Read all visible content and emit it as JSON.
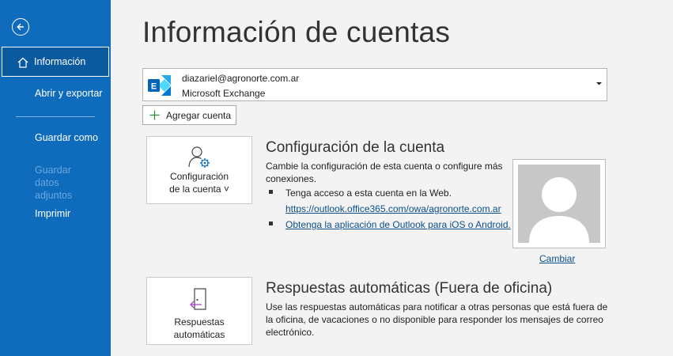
{
  "sidebar": {
    "back_label": "Atrás",
    "items": [
      {
        "label": "Información"
      },
      {
        "label": "Abrir y exportar"
      },
      {
        "label": "Guardar como"
      },
      {
        "label": "Guardar datos adjuntos"
      },
      {
        "label": "Imprimir"
      }
    ]
  },
  "page": {
    "title": "Información de cuentas"
  },
  "account": {
    "email": "diazariel@agronorte.com.ar",
    "type": "Microsoft Exchange",
    "add_label": "Agregar cuenta"
  },
  "account_settings": {
    "tile_line1": "Configuración",
    "tile_line2": "de la cuenta ˅",
    "title": "Configuración de la cuenta",
    "description": "Cambie la configuración de esta cuenta o configure más conexiones.",
    "bullet1": "Tenga acceso a esta cuenta en la Web.",
    "link1": "https://outlook.office365.com/owa/agronorte.com.ar",
    "link2": "Obtenga la aplicación de Outlook para iOS o Android.",
    "change_photo": "Cambiar"
  },
  "auto_replies": {
    "tile_line1": "Respuestas",
    "tile_line2": "automáticas",
    "title": "Respuestas automáticas (Fuera de oficina)",
    "description": "Use las respuestas automáticas para notificar a otras personas que está fuera de la oficina, de vacaciones o no disponible para responder los mensajes de correo electrónico."
  },
  "colors": {
    "sidebar": "#0f6cbd",
    "accent_link": "#0b4f8a",
    "background": "#f3f3f3"
  }
}
